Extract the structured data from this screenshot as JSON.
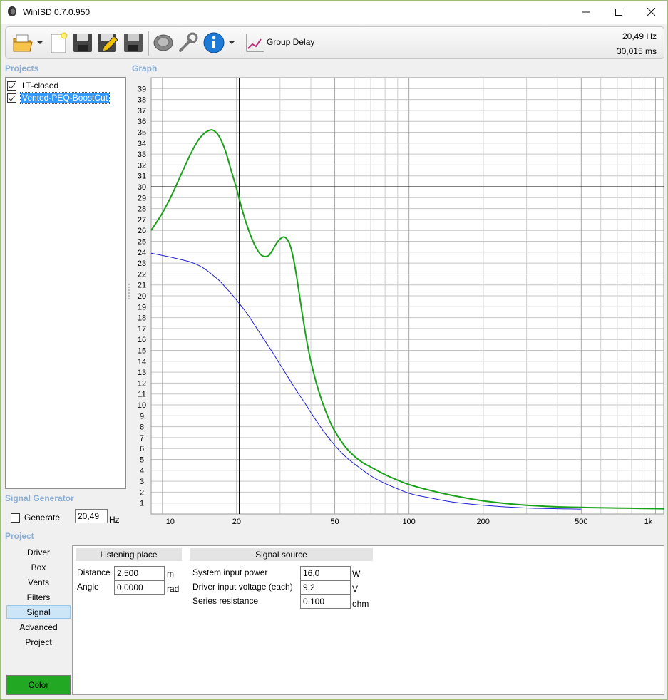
{
  "window": {
    "title": "WinISD 0.7.0.950"
  },
  "toolbar": {
    "group_delay_label": "Group Delay",
    "readout_freq": "20,49 Hz",
    "readout_value": "30,015 ms",
    "icons": [
      "open-folder-icon",
      "new-document-icon",
      "save-icon",
      "edit-icon",
      "save-as-icon",
      "driver-icon",
      "tools-icon",
      "info-icon",
      "group-delay-icon"
    ]
  },
  "projects": {
    "label": "Projects",
    "items": [
      {
        "label": "LT-closed",
        "checked": true,
        "selected": false
      },
      {
        "label": "Vented-PEQ-BoostCut",
        "checked": true,
        "selected": true
      }
    ]
  },
  "signal_generator": {
    "label": "Signal Generator",
    "generate_label": "Generate",
    "generate_checked": false,
    "frequency": "20,49",
    "unit": "Hz"
  },
  "graph": {
    "label": "Graph",
    "y_ticks": [
      "1",
      "2",
      "3",
      "4",
      "5",
      "6",
      "7",
      "8",
      "9",
      "10",
      "11",
      "12",
      "13",
      "14",
      "15",
      "16",
      "17",
      "18",
      "19",
      "20",
      "21",
      "22",
      "23",
      "24",
      "25",
      "26",
      "27",
      "28",
      "29",
      "30",
      "31",
      "32",
      "33",
      "34",
      "35",
      "36",
      "37",
      "38",
      "39"
    ],
    "x_tick_labels": [
      "10",
      "20",
      "50",
      "100",
      "200",
      "500",
      "1k"
    ],
    "cursor": {
      "x": 20.49,
      "y": 30
    }
  },
  "chart_data": {
    "type": "line",
    "title": "",
    "xlabel": "",
    "ylabel": "",
    "x_scale": "log",
    "xlim": [
      9,
      1080
    ],
    "ylim": [
      0,
      40
    ],
    "grid": true,
    "series": [
      {
        "name": "Vented-PEQ-BoostCut",
        "color": "#1aa11a",
        "x": [
          9,
          10,
          11,
          12,
          13,
          14,
          15,
          16,
          17,
          18,
          19,
          20,
          21,
          22,
          23,
          24,
          25,
          26,
          27,
          28,
          29,
          30,
          31,
          32,
          33,
          34,
          35,
          36,
          37,
          38,
          39,
          40,
          42,
          44,
          46,
          48,
          50,
          55,
          60,
          65,
          70,
          80,
          90,
          100,
          120,
          150,
          200,
          300,
          500,
          1000,
          1080
        ],
        "y": [
          26.0,
          27.6,
          29.4,
          31.3,
          33.0,
          34.3,
          35.0,
          35.2,
          34.6,
          33.3,
          31.5,
          29.8,
          28.0,
          26.5,
          25.3,
          24.4,
          23.8,
          23.6,
          23.7,
          24.2,
          24.8,
          25.2,
          25.4,
          25.2,
          24.6,
          23.4,
          21.8,
          20.0,
          18.2,
          16.6,
          15.2,
          14.0,
          12.1,
          10.6,
          9.4,
          8.4,
          7.6,
          6.2,
          5.3,
          4.7,
          4.3,
          3.6,
          3.1,
          2.7,
          2.2,
          1.7,
          1.2,
          0.8,
          0.6,
          0.5,
          0.45
        ]
      },
      {
        "name": "LT-closed",
        "color": "#2020d0",
        "x": [
          9,
          10,
          11,
          12,
          13,
          14,
          15,
          16,
          17,
          18,
          19,
          20,
          22,
          24,
          26,
          28,
          30,
          32,
          35,
          38,
          40,
          45,
          50,
          55,
          60,
          70,
          80,
          100,
          120,
          150,
          200,
          300,
          500
        ],
        "y": [
          23.9,
          23.7,
          23.5,
          23.3,
          23.1,
          22.8,
          22.4,
          21.9,
          21.4,
          20.8,
          20.2,
          19.6,
          18.4,
          17.1,
          15.9,
          14.8,
          13.7,
          12.7,
          11.3,
          10.1,
          9.3,
          7.6,
          6.3,
          5.3,
          4.6,
          3.5,
          2.8,
          1.9,
          1.5,
          1.1,
          0.8,
          0.55,
          0.45
        ]
      }
    ]
  },
  "project_panel": {
    "label": "Project",
    "nav": [
      "Driver",
      "Box",
      "Vents",
      "Filters",
      "Signal",
      "Advanced",
      "Project"
    ],
    "active": "Signal",
    "color_label": "Color",
    "listening_place": {
      "header": "Listening place",
      "distance_label": "Distance",
      "distance_value": "2,500",
      "distance_unit": "m",
      "angle_label": "Angle",
      "angle_value": "0,0000",
      "angle_unit": "rad"
    },
    "signal_source": {
      "header": "Signal source",
      "power_label": "System input power",
      "power_value": "16,0",
      "power_unit": "W",
      "voltage_label": "Driver input voltage (each)",
      "voltage_value": "9,2",
      "voltage_unit": "V",
      "resistance_label": "Series resistance",
      "resistance_value": "0,100",
      "resistance_unit": "ohm"
    }
  }
}
